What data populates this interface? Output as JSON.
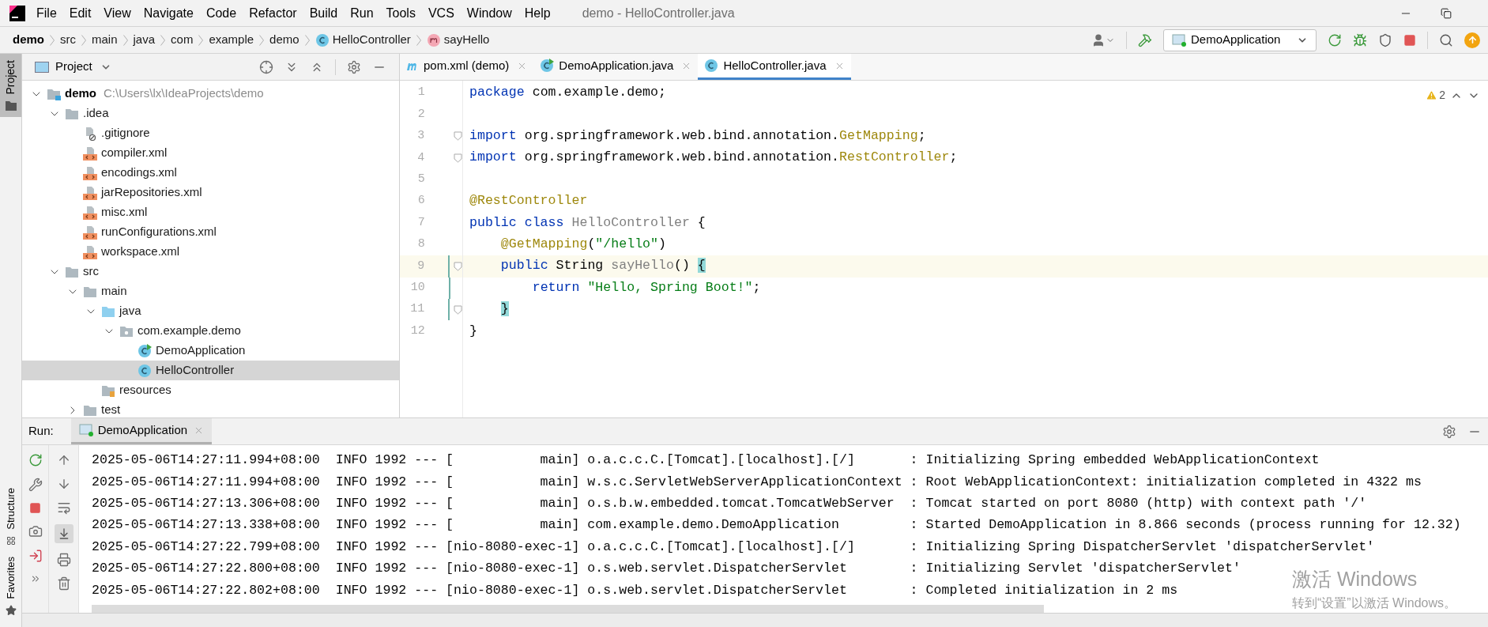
{
  "menu_bar": {
    "items": [
      "File",
      "Edit",
      "View",
      "Navigate",
      "Code",
      "Refactor",
      "Build",
      "Run",
      "Tools",
      "VCS",
      "Window",
      "Help"
    ],
    "title": "demo - HelloController.java"
  },
  "breadcrumbs": [
    {
      "label": "demo",
      "kind": "project"
    },
    {
      "label": "src",
      "kind": "plain"
    },
    {
      "label": "main",
      "kind": "plain"
    },
    {
      "label": "java",
      "kind": "plain"
    },
    {
      "label": "com",
      "kind": "plain"
    },
    {
      "label": "example",
      "kind": "plain"
    },
    {
      "label": "demo",
      "kind": "plain"
    },
    {
      "label": "HelloController",
      "kind": "class"
    },
    {
      "label": "sayHello",
      "kind": "method"
    }
  ],
  "toolbar": {
    "run_configuration": "DemoApplication"
  },
  "left_strip": [
    {
      "label": "Project",
      "selected": true
    }
  ],
  "project_panel": {
    "title": "Project",
    "tree": [
      {
        "label": "demo",
        "hint": "C:\\Users\\lx\\IdeaProjects\\demo",
        "kind": "module",
        "expanded": true,
        "selected": false,
        "children": [
          {
            "label": ".idea",
            "kind": "folder",
            "expanded": true,
            "selected": false,
            "children": [
              {
                "label": ".gitignore",
                "kind": "ignore",
                "selected": false
              },
              {
                "label": "compiler.xml",
                "kind": "xml",
                "selected": false
              },
              {
                "label": "encodings.xml",
                "kind": "xml",
                "selected": false
              },
              {
                "label": "jarRepositories.xml",
                "kind": "xml",
                "selected": false
              },
              {
                "label": "misc.xml",
                "kind": "xml",
                "selected": false
              },
              {
                "label": "runConfigurations.xml",
                "kind": "xml",
                "selected": false
              },
              {
                "label": "workspace.xml",
                "kind": "xml",
                "selected": false
              }
            ]
          },
          {
            "label": "src",
            "kind": "folder",
            "expanded": true,
            "selected": false,
            "children": [
              {
                "label": "main",
                "kind": "folder",
                "expanded": true,
                "selected": false,
                "children": [
                  {
                    "label": "java",
                    "kind": "source",
                    "expanded": true,
                    "selected": false,
                    "children": [
                      {
                        "label": "com.example.demo",
                        "kind": "package",
                        "expanded": true,
                        "selected": false,
                        "children": [
                          {
                            "label": "DemoApplication",
                            "kind": "app",
                            "selected": false
                          },
                          {
                            "label": "HelloController",
                            "kind": "class",
                            "selected": true
                          }
                        ]
                      }
                    ]
                  },
                  {
                    "label": "resources",
                    "kind": "resources",
                    "selected": false
                  }
                ]
              },
              {
                "label": "test",
                "kind": "folder",
                "expanded": false,
                "selected": false
              }
            ]
          }
        ]
      }
    ]
  },
  "editor": {
    "tabs": [
      {
        "label": "pom.xml (demo)",
        "kind": "maven",
        "selected": false
      },
      {
        "label": "DemoApplication.java",
        "kind": "app",
        "selected": false
      },
      {
        "label": "HelloController.java",
        "kind": "class",
        "selected": true
      }
    ],
    "warnings": "2",
    "lines": [
      {
        "number": "1",
        "current": false,
        "fold": false,
        "modified": false,
        "tokens": [
          {
            "text": "package",
            "kind": "keyword"
          },
          {
            "text": " com.example.demo;",
            "kind": "plain"
          }
        ]
      },
      {
        "number": "2",
        "current": false,
        "fold": false,
        "modified": false
      },
      {
        "number": "3",
        "current": false,
        "fold": true,
        "modified": false,
        "tokens": [
          {
            "text": "import",
            "kind": "keyword"
          },
          {
            "text": " org.springframework.web.bind.annotation.",
            "kind": "plain"
          },
          {
            "text": "GetMapping",
            "kind": "annotation"
          },
          {
            "text": ";",
            "kind": "plain"
          }
        ]
      },
      {
        "number": "4",
        "current": false,
        "fold": true,
        "modified": false,
        "tokens": [
          {
            "text": "import",
            "kind": "keyword"
          },
          {
            "text": " org.springframework.web.bind.annotation.",
            "kind": "plain"
          },
          {
            "text": "RestController",
            "kind": "annotation"
          },
          {
            "text": ";",
            "kind": "plain"
          }
        ]
      },
      {
        "number": "5",
        "current": false,
        "fold": false,
        "modified": false
      },
      {
        "number": "6",
        "current": false,
        "fold": false,
        "modified": false,
        "tokens": [
          {
            "text": "@RestController",
            "kind": "annotation"
          }
        ]
      },
      {
        "number": "7",
        "current": false,
        "fold": false,
        "modified": false,
        "tokens": [
          {
            "text": "public class",
            "kind": "keyword"
          },
          {
            "text": " HelloController",
            "kind": "unused"
          },
          {
            "text": " {",
            "kind": "plain"
          }
        ]
      },
      {
        "number": "8",
        "current": false,
        "fold": false,
        "modified": false,
        "tokens": [
          {
            "text": "    @GetMapping",
            "kind": "annotation"
          },
          {
            "text": "(",
            "kind": "plain"
          },
          {
            "text": "\"/hello\"",
            "kind": "string"
          },
          {
            "text": ")",
            "kind": "plain"
          }
        ]
      },
      {
        "number": "9",
        "current": true,
        "fold": true,
        "modified": true,
        "tokens": [
          {
            "text": "    public",
            "kind": "keyword"
          },
          {
            "text": " String ",
            "kind": "plain"
          },
          {
            "text": "sayHello",
            "kind": "unused"
          },
          {
            "text": "() ",
            "kind": "plain"
          },
          {
            "text": "{",
            "kind": "brace"
          }
        ]
      },
      {
        "number": "10",
        "current": false,
        "fold": false,
        "modified": true,
        "tokens": [
          {
            "text": "        return",
            "kind": "keyword"
          },
          {
            "text": " \"Hello, Spring Boot!\"",
            "kind": "string"
          },
          {
            "text": ";",
            "kind": "plain"
          }
        ]
      },
      {
        "number": "11",
        "current": false,
        "fold": true,
        "modified": true,
        "tokens": [
          {
            "text": "    }",
            "kind": "brace"
          }
        ]
      },
      {
        "number": "12",
        "current": false,
        "fold": false,
        "modified": false,
        "tokens": [
          {
            "text": "}",
            "kind": "plain"
          }
        ]
      }
    ]
  },
  "run_panel": {
    "label": "Run:",
    "tabs": [
      {
        "label": "DemoApplication",
        "selected": true
      }
    ],
    "log": [
      "2025-05-06T14:27:11.994+08:00  INFO 1992 --- [           main] o.a.c.c.C.[Tomcat].[localhost].[/]       : Initializing Spring embedded WebApplicationContext",
      "2025-05-06T14:27:11.994+08:00  INFO 1992 --- [           main] w.s.c.ServletWebServerApplicationContext : Root WebApplicationContext: initialization completed in 4322 ms",
      "2025-05-06T14:27:13.306+08:00  INFO 1992 --- [           main] o.s.b.w.embedded.tomcat.TomcatWebServer  : Tomcat started on port 8080 (http) with context path '/'",
      "2025-05-06T14:27:13.338+08:00  INFO 1992 --- [           main] com.example.demo.DemoApplication         : Started DemoApplication in 8.866 seconds (process running for 12.32)",
      "2025-05-06T14:27:22.799+08:00  INFO 1992 --- [nio-8080-exec-1] o.a.c.c.C.[Tomcat].[localhost].[/]       : Initializing Spring DispatcherServlet 'dispatcherServlet'",
      "2025-05-06T14:27:22.800+08:00  INFO 1992 --- [nio-8080-exec-1] o.s.web.servlet.DispatcherServlet        : Initializing Servlet 'dispatcherServlet'",
      "2025-05-06T14:27:22.802+08:00  INFO 1992 --- [nio-8080-exec-1] o.s.web.servlet.DispatcherServlet        : Completed initialization in 2 ms"
    ]
  },
  "bottom_strip": [
    {
      "label": "Structure",
      "kind": "structure"
    },
    {
      "label": "Favorites",
      "kind": "favorites"
    }
  ],
  "activation_notice": {
    "title": "激活 Windows",
    "subtitle": "转到“设置”以激活 Windows。"
  }
}
